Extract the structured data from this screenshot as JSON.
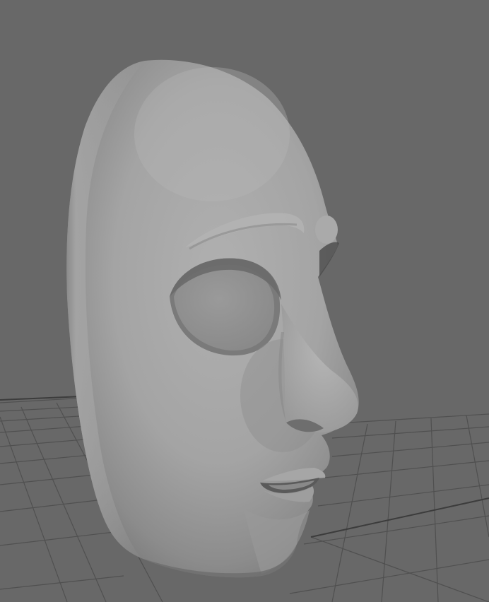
{
  "viewport": {
    "background_color": "#686868",
    "grid_line_color": "#4d4d4d",
    "grid_major_line_color": "#3a3a3a",
    "grid_visible": true,
    "shading_mode": "smooth-gray"
  },
  "model": {
    "object": "face-mask",
    "view": "three-quarter-right",
    "base_color": "#a2a2a2",
    "highlight_color": "#b4b4b4",
    "shadow_color": "#5e5e5e"
  }
}
